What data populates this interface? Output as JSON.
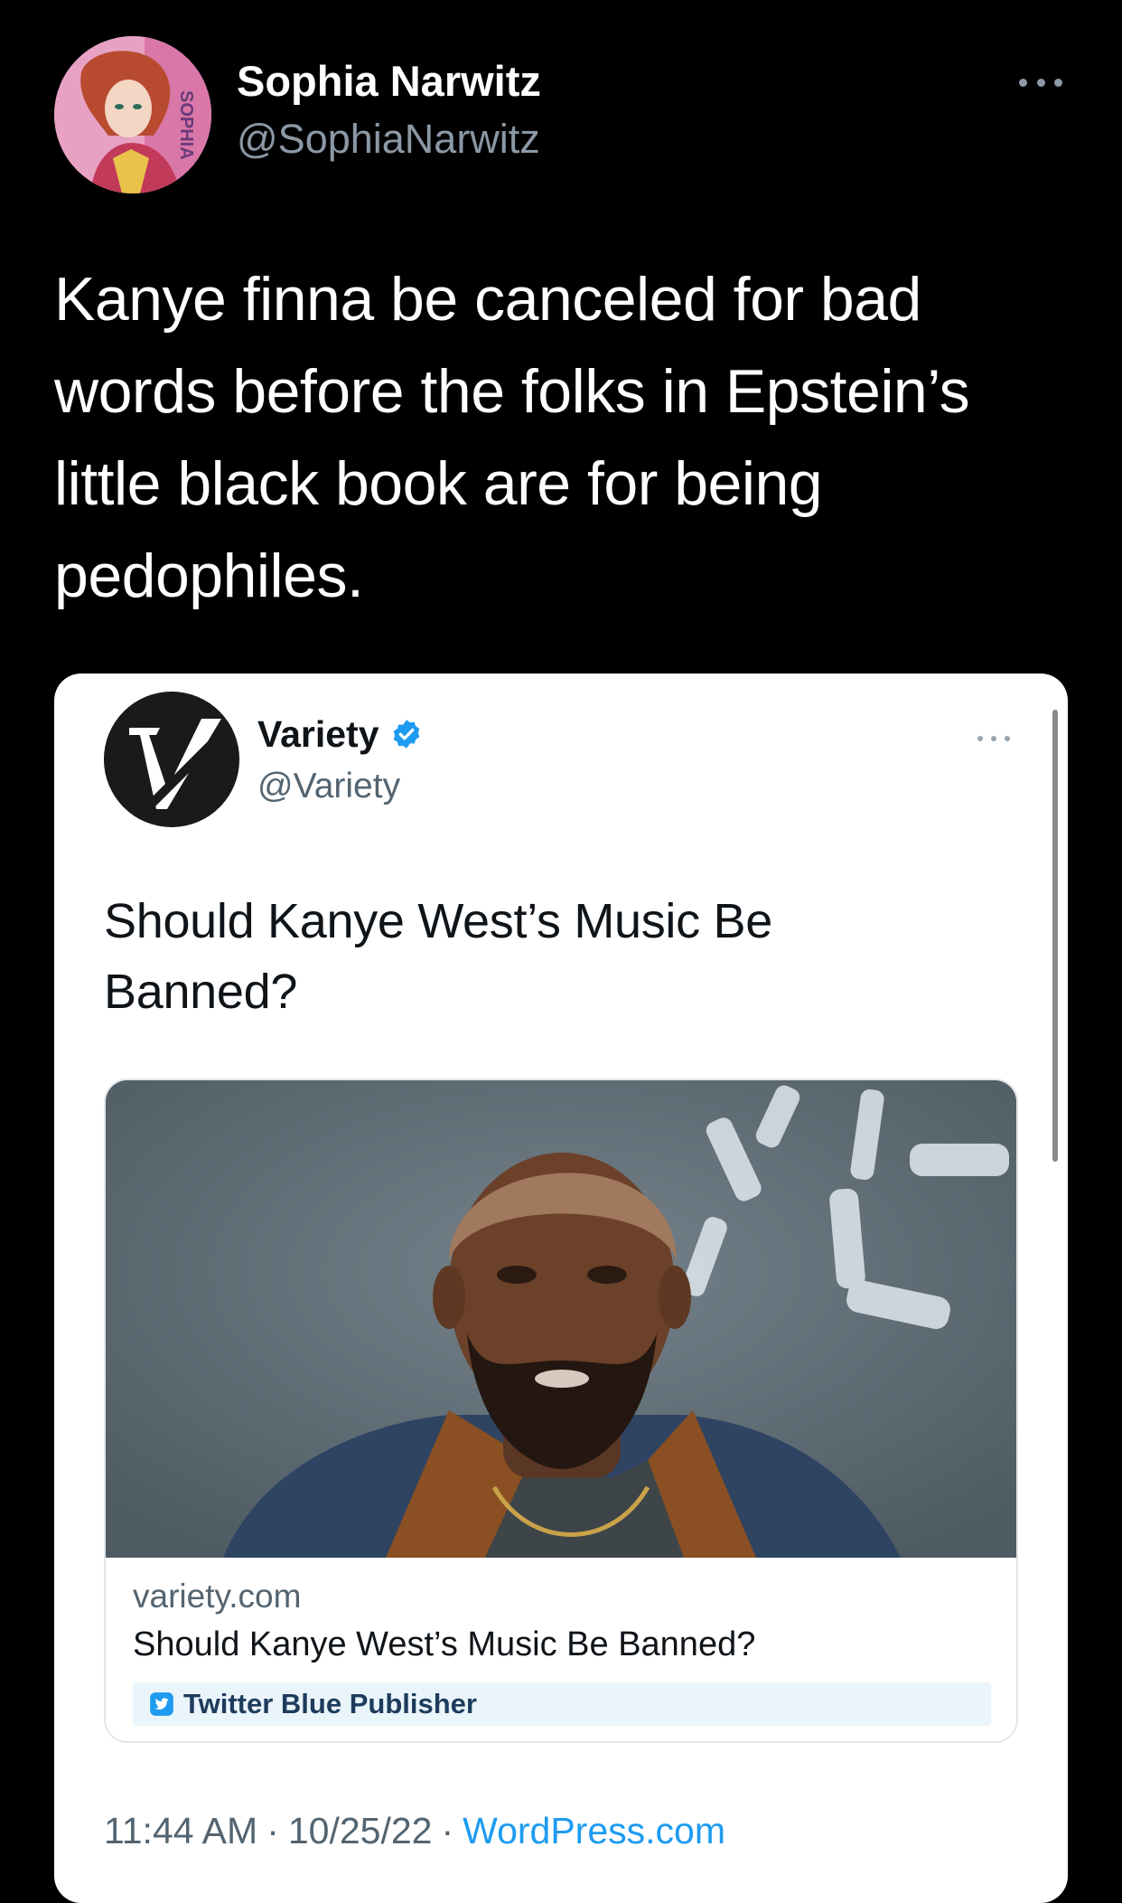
{
  "tweet": {
    "author_name": "Sophia Narwitz",
    "author_handle": "@SophiaNarwitz",
    "avatar_art_text": "SOPHIA",
    "text": "Kanye finna be canceled for bad words before the folks in Epstein’s little black book are for being pedophiles.",
    "more_icon": "ellipsis-icon"
  },
  "quote": {
    "author_name": "Variety",
    "verified": true,
    "author_handle": "@Variety",
    "logo_letter": "V",
    "text": "Should Kanye West’s Music Be Banned?",
    "link": {
      "domain": "variety.com",
      "title": "Should Kanye West’s Music Be Banned?",
      "badge": "Twitter Blue Publisher"
    },
    "time": "11:44 AM",
    "separator": "·",
    "date": "10/25/22",
    "source": "WordPress.com"
  },
  "colors": {
    "background": "#000000",
    "card": "#ffffff",
    "accent_link": "#1d9bf0",
    "verified": "#1d9bf0",
    "muted": "#536471"
  }
}
